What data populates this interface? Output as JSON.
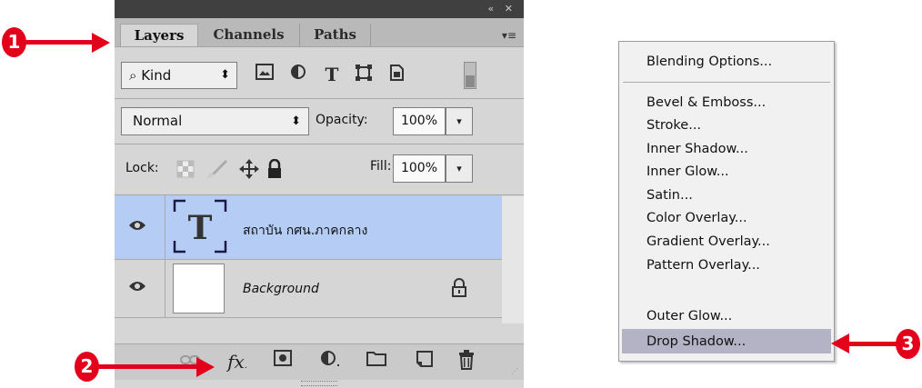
{
  "panel": {
    "tabs": [
      {
        "label": "Layers",
        "active": true
      },
      {
        "label": "Channels",
        "active": false
      },
      {
        "label": "Paths",
        "active": false
      }
    ],
    "topbar_buttons": "« ✕",
    "menu_icon": "▾≡",
    "filter": {
      "kind_label": "Kind",
      "search_icon": "⌕",
      "arrows": "⬍"
    },
    "filter_icons": [
      "pixel-layer-filter-icon",
      "adjustment-layer-filter-icon",
      "type-layer-filter-icon",
      "shape-layer-filter-icon",
      "smart-object-filter-icon",
      "filter-toggle-icon"
    ],
    "blend_mode": "Normal",
    "opacity_label": "Opacity:",
    "opacity_value": "100%",
    "lock_label": "Lock:",
    "fill_label": "Fill:",
    "fill_value": "100%",
    "layers": [
      {
        "name": "สถาบัน กศน.ภาคกลาง",
        "type": "text",
        "selected": true
      },
      {
        "name": "Background",
        "type": "background",
        "selected": false,
        "locked": true
      }
    ],
    "bottom_icons": [
      "link-layers-icon",
      "fx-icon",
      "add-mask-icon",
      "new-adjustment-layer-icon",
      "new-group-icon",
      "new-layer-icon",
      "delete-layer-icon"
    ]
  },
  "context_menu": {
    "header_item": "Blending Options...",
    "items": [
      "Bevel & Emboss...",
      "Stroke...",
      "Inner Shadow...",
      "Inner Glow...",
      "Satin...",
      "Color Overlay...",
      "Gradient Overlay...",
      "Pattern Overlay...",
      "Outer Glow...",
      "Drop Shadow..."
    ],
    "highlighted": "Drop Shadow..."
  },
  "annotations": {
    "markers": [
      "1",
      "2",
      "3"
    ],
    "color": "#e2001a"
  },
  "colors": {
    "selected_layer": "#b5cdf5",
    "menu_highlight": "#b4b3c6",
    "panel_bg": "#d6d6d6"
  }
}
